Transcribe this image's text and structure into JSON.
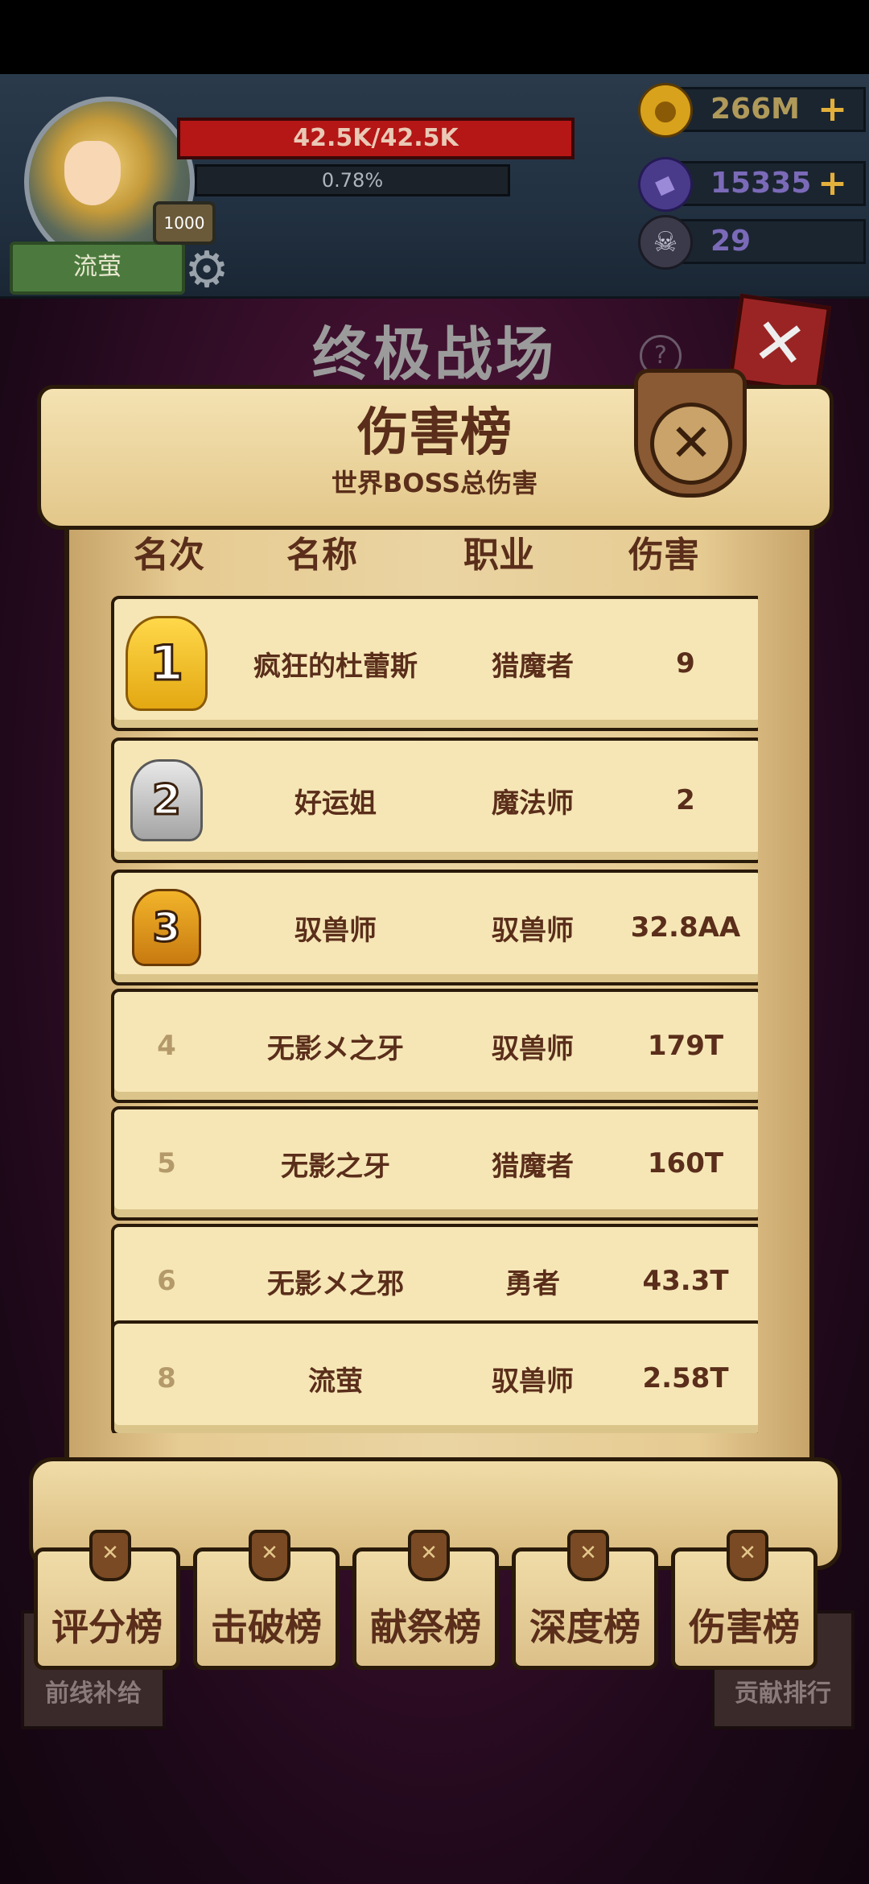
{
  "player": {
    "name": "流萤",
    "level": "1000",
    "hp": "42.5K/42.5K",
    "exp": "0.78%"
  },
  "resources": {
    "gold": "266M",
    "gems": "15335",
    "skulls": "29"
  },
  "screen_title": "终极战场",
  "panel": {
    "title": "伤害榜",
    "subtitle": "世界BOSS总伤害",
    "columns": [
      "名次",
      "名称",
      "职业",
      "伤害"
    ],
    "rows": [
      {
        "rank": "1",
        "name": "疯狂的杜蕾斯",
        "job": "猎魔者",
        "damage": "9"
      },
      {
        "rank": "2",
        "name": "好运姐",
        "job": "魔法师",
        "damage": "2"
      },
      {
        "rank": "3",
        "name": "驭兽师",
        "job": "驭兽师",
        "damage": "32.8AA"
      },
      {
        "rank": "4",
        "name": "无影メ之牙",
        "job": "驭兽师",
        "damage": "179T"
      },
      {
        "rank": "5",
        "name": "无影之牙",
        "job": "猎魔者",
        "damage": "160T"
      },
      {
        "rank": "6",
        "name": "无影メ之邪",
        "job": "勇者",
        "damage": "43.3T"
      },
      {
        "rank": "8",
        "name": "流萤",
        "job": "驭兽师",
        "damage": "2.58T"
      }
    ]
  },
  "tabs": [
    "评分榜",
    "击破榜",
    "献祭榜",
    "深度榜",
    "伤害榜"
  ],
  "background_buttons": {
    "left": "前线补给",
    "right": "贡献排行"
  },
  "icons": {
    "close": "close-icon",
    "help": "help-icon",
    "settings": "gear-icon",
    "plus": "plus-icon"
  },
  "colors": {
    "hp": "#b51616",
    "parchment": "#f6e6b6",
    "ink": "#5a2e1a",
    "gold_medal": "#ffd84a",
    "silver_medal": "#c4c4c4",
    "bronze_medal": "#e09a1e"
  }
}
